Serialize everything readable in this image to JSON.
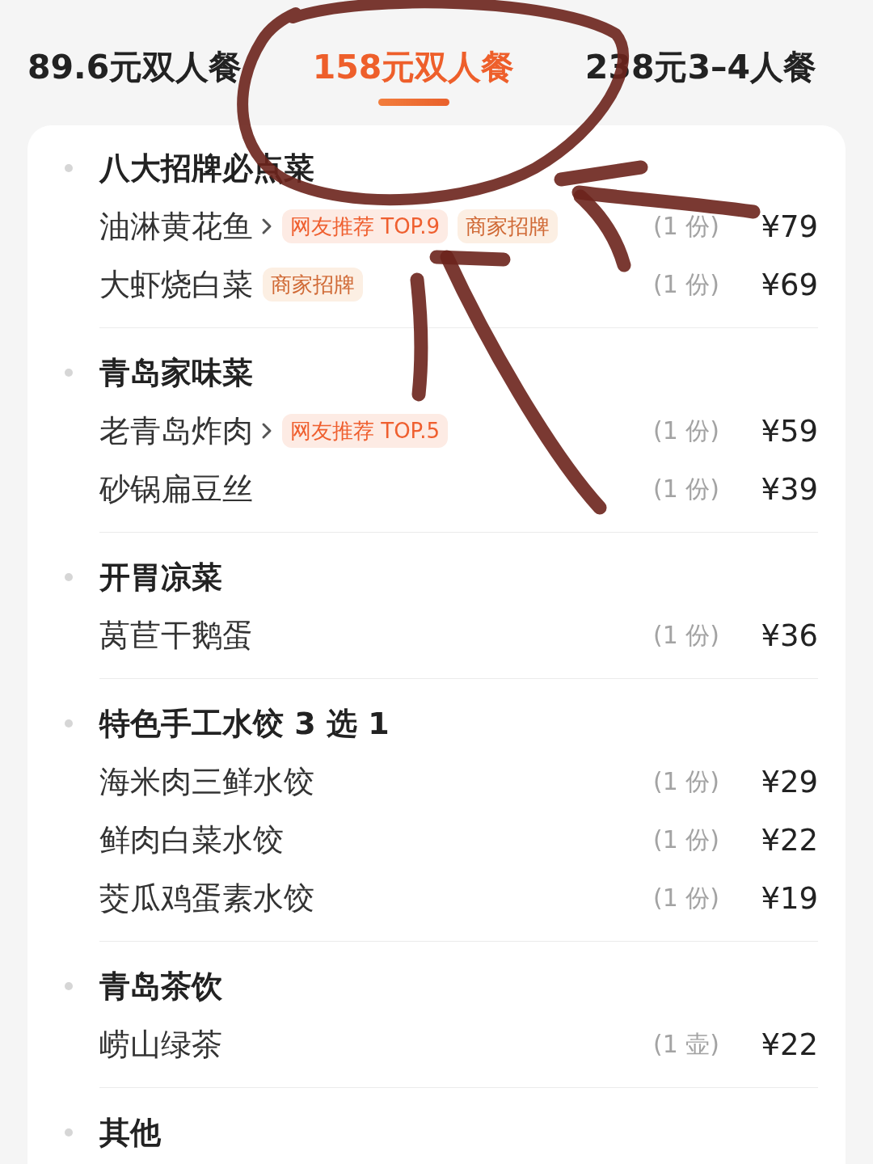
{
  "tabs": [
    {
      "label": "89.6元双人餐",
      "selected": false
    },
    {
      "label": "158元双人餐",
      "selected": true
    },
    {
      "label": "238元3–4人餐",
      "selected": false
    }
  ],
  "menu": {
    "sections": [
      {
        "title": "八大招牌必点菜",
        "items": [
          {
            "name": "油淋黄花鱼",
            "has_details": true,
            "tags": [
              {
                "text": "网友推荐 TOP.9",
                "kind": "ranking"
              },
              {
                "text": "商家招牌",
                "kind": "signature"
              }
            ],
            "quantity": "(1 份)",
            "price": "¥79"
          },
          {
            "name": "大虾烧白菜",
            "has_details": false,
            "tags": [
              {
                "text": "商家招牌",
                "kind": "signature"
              }
            ],
            "quantity": "(1 份)",
            "price": "¥69"
          }
        ]
      },
      {
        "title": "青岛家味菜",
        "items": [
          {
            "name": "老青岛炸肉",
            "has_details": true,
            "tags": [
              {
                "text": "网友推荐 TOP.5",
                "kind": "ranking"
              }
            ],
            "quantity": "(1 份)",
            "price": "¥59"
          },
          {
            "name": "砂锅扁豆丝",
            "has_details": false,
            "quantity": "(1 份)",
            "price": "¥39"
          }
        ]
      },
      {
        "title": "开胃凉菜",
        "items": [
          {
            "name": "莴苣干鹅蛋",
            "has_details": false,
            "quantity": "(1 份)",
            "price": "¥36"
          }
        ]
      },
      {
        "title": "特色手工水饺 3 选 1",
        "items": [
          {
            "name": "海米肉三鲜水饺",
            "has_details": false,
            "quantity": "(1 份)",
            "price": "¥29"
          },
          {
            "name": "鲜肉白菜水饺",
            "has_details": false,
            "quantity": "(1 份)",
            "price": "¥22"
          },
          {
            "name": "茭瓜鸡蛋素水饺",
            "has_details": false,
            "quantity": "(1 份)",
            "price": "¥19"
          }
        ]
      },
      {
        "title": "青岛茶饮",
        "items": [
          {
            "name": "崂山绿茶",
            "has_details": false,
            "quantity": "(1 壶)",
            "price": "¥22"
          }
        ]
      },
      {
        "title": "其他"
      }
    ]
  }
}
